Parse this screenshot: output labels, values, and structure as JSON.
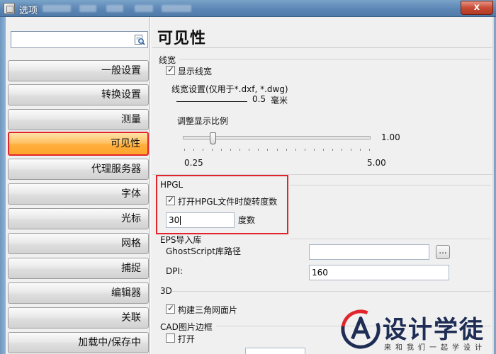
{
  "window": {
    "title": "选项",
    "close_label": "x"
  },
  "search": {
    "value": ""
  },
  "nav": {
    "items": [
      {
        "label": "一般设置"
      },
      {
        "label": "转换设置"
      },
      {
        "label": "测量"
      },
      {
        "label": "可见性",
        "active": true
      },
      {
        "label": "代理服务器"
      },
      {
        "label": "字体"
      },
      {
        "label": "光标"
      },
      {
        "label": "网格"
      },
      {
        "label": "捕捉"
      },
      {
        "label": "编辑器"
      },
      {
        "label": "关联"
      },
      {
        "label": "加载中/保存中"
      }
    ]
  },
  "page": {
    "title": "可见性"
  },
  "linewidth": {
    "section_title": "线宽",
    "show_label": "显示线宽",
    "show_checked": true,
    "settings_label": "线宽设置(仅用于*.dxf, *.dwg)",
    "value": "0.5",
    "unit": "毫米",
    "scale_label": "调整显示比例",
    "slider_value": "1.00",
    "slider_min": "0.25",
    "slider_max": "5.00",
    "slider_fraction": 0.158
  },
  "hpgl": {
    "section_title": "HPGL",
    "rotate_label": "打开HPGL文件时旋转度数",
    "rotate_checked": true,
    "degrees_value": "30",
    "degrees_unit": "度数"
  },
  "eps": {
    "section_title": "EPS导入库",
    "ghostscript_label": "GhostScript库路径",
    "ghostscript_value": "",
    "browse_label": "...",
    "dpi_label": "DPI:",
    "dpi_value": "160"
  },
  "three_d": {
    "section_title": "3D",
    "mesh_label": "构建三角网面片",
    "mesh_checked": true
  },
  "cad_frame": {
    "section_title": "CAD图片边框",
    "open_label": "打开",
    "open_checked": false
  },
  "watermark": {
    "title": "设计学徒",
    "subtitle": "来和我们一起学设计"
  },
  "colors": {
    "active_nav": "#ffb347",
    "highlight_border": "#e0262c",
    "titlebar": "#5c86b4"
  }
}
